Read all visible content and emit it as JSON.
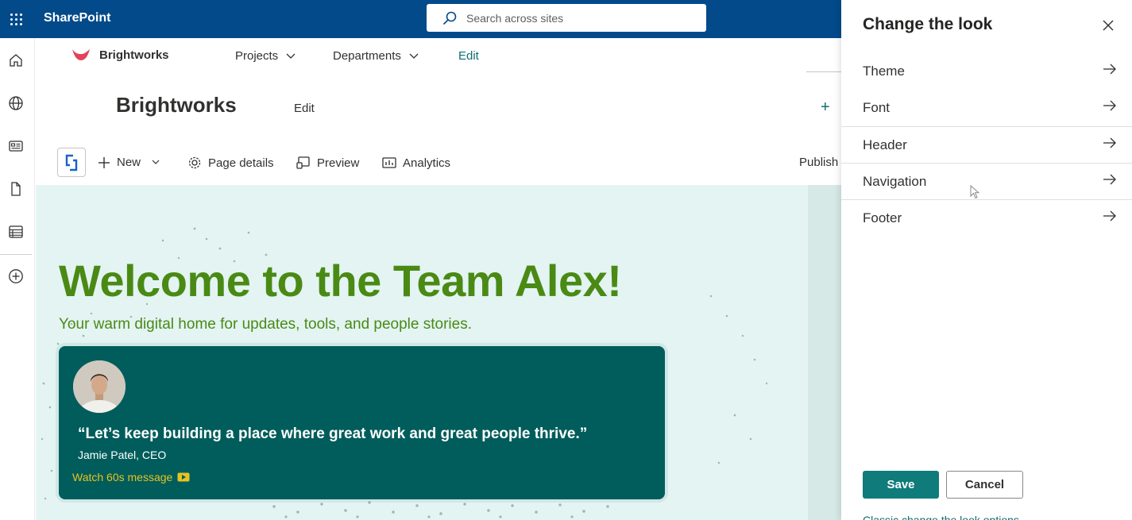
{
  "suite": {
    "brand": "SharePoint",
    "search_placeholder": "Search across sites"
  },
  "rail": {
    "items": [
      "home-icon",
      "globe-icon",
      "news-icon",
      "file-icon",
      "list-icon",
      "add-icon"
    ]
  },
  "hub": {
    "site_name": "Brightworks",
    "links": [
      {
        "label": "Projects",
        "has_dropdown": true
      },
      {
        "label": "Departments",
        "has_dropdown": true
      },
      {
        "label": "Edit",
        "has_dropdown": false
      }
    ]
  },
  "site": {
    "title": "Brightworks",
    "edit_label": "Edit",
    "add_symbol": "+"
  },
  "commands": {
    "new_label": "New",
    "page_details_label": "Page details",
    "preview_label": "Preview",
    "analytics_label": "Analytics",
    "publish_label": "Publish"
  },
  "hero": {
    "heading": "Welcome to the Team Alex!",
    "tagline": "Your warm digital home for updates, tools, and people stories.",
    "quote": "“Let’s keep building a place where great work and great people thrive.”",
    "author": "Jamie Patel, CEO",
    "watch_label": "Watch 60s message"
  },
  "panel": {
    "title": "Change the look",
    "items": [
      "Theme",
      "Font",
      "Header",
      "Navigation",
      "Footer"
    ],
    "save_label": "Save",
    "cancel_label": "Cancel",
    "classic_link": "Classic change the look options"
  },
  "colors": {
    "suite_bar": "#034a8a",
    "accent_teal": "#0f7b7b",
    "hero_green": "#4a8a14",
    "quote_card": "#005d5b",
    "watch_gold": "#e6c222",
    "canvas_bg": "#e3f4f3"
  }
}
